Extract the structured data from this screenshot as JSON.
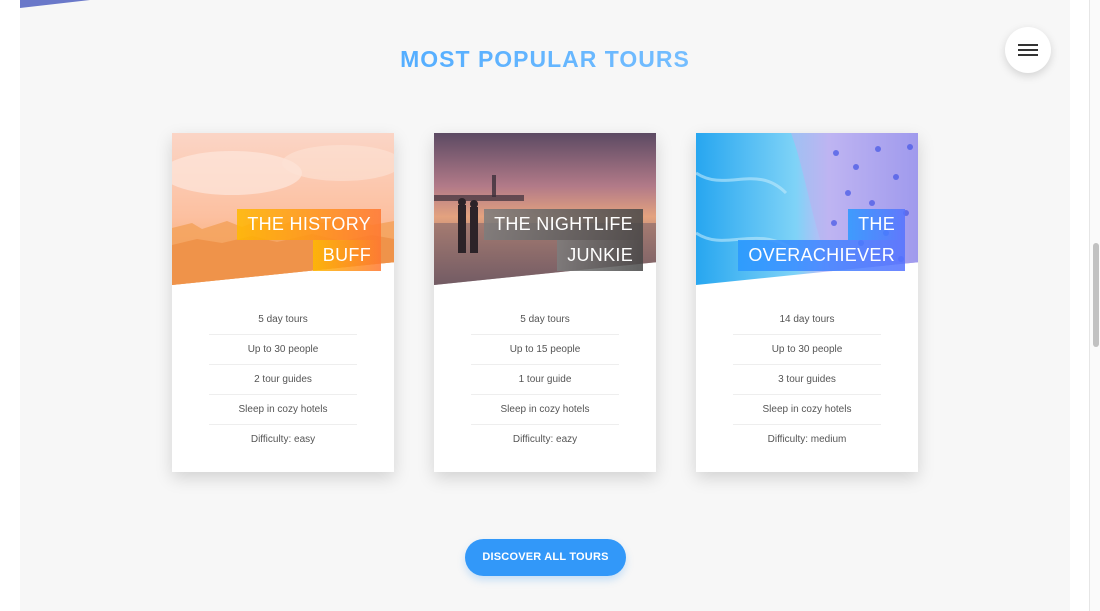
{
  "section": {
    "title": "MOST POPULAR TOURS"
  },
  "navigation": {
    "toggle_icon": "menu-icon"
  },
  "cards": [
    {
      "title_lines": [
        "THE HISTORY",
        "BUFF"
      ],
      "photo": "city-skyline-photo",
      "details": [
        "5 day tours",
        "Up to 30 people",
        "2 tour guides",
        "Sleep in cozy hotels",
        "Difficulty: easy"
      ]
    },
    {
      "title_lines": [
        "THE NIGHTLIFE",
        "JUNKIE"
      ],
      "photo": "beach-sunset-photo",
      "details": [
        "5 day tours",
        "Up to 15 people",
        "1 tour guide",
        "Sleep in cozy hotels",
        "Difficulty: eazy"
      ]
    },
    {
      "title_lines": [
        "THE",
        "OVERACHIEVER"
      ],
      "photo": "aerial-beach-photo",
      "details": [
        "14 day tours",
        "Up to 30 people",
        "3 tour guides",
        "Sleep in cozy hotels",
        "Difficulty: medium"
      ]
    }
  ],
  "cta": {
    "label": "DISCOVER ALL TOURS"
  },
  "colors": {
    "primary": "#2998ff",
    "secondary": "#5643fa",
    "orange": "#ff7730",
    "grey": "#777777"
  }
}
